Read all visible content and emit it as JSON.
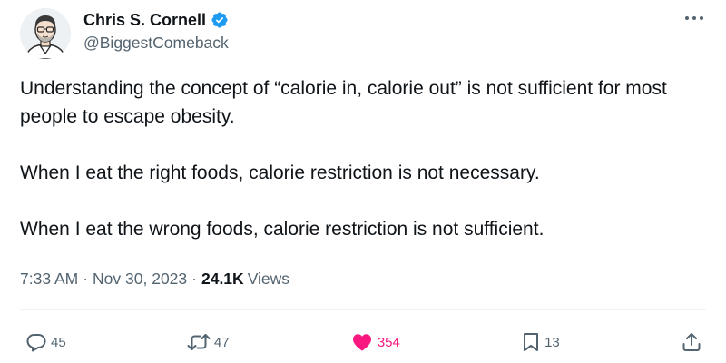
{
  "author": {
    "display_name": "Chris S. Cornell",
    "handle": "@BiggestComeback",
    "verified": true,
    "verified_color": "#1d9bf0"
  },
  "tweet": {
    "paragraphs": [
      "Understanding the concept of “calorie in, calorie out” is not sufficient for most people to escape obesity.",
      "When I eat the right foods, calorie restriction is not necessary.",
      "When I eat the wrong foods, calorie restriction is not sufficient."
    ]
  },
  "meta": {
    "time": "7:33 AM",
    "separator": "·",
    "date": "Nov 30, 2023",
    "views_count": "24.1K",
    "views_label": "Views"
  },
  "actions": {
    "replies": "45",
    "reposts": "47",
    "likes": "354",
    "likes_color": "#f91880",
    "bookmarks": "13"
  },
  "icons": {
    "reply": "reply-icon",
    "repost": "repost-icon",
    "like": "heart-icon",
    "bookmark": "bookmark-icon",
    "share": "share-icon",
    "more": "more-icon"
  }
}
